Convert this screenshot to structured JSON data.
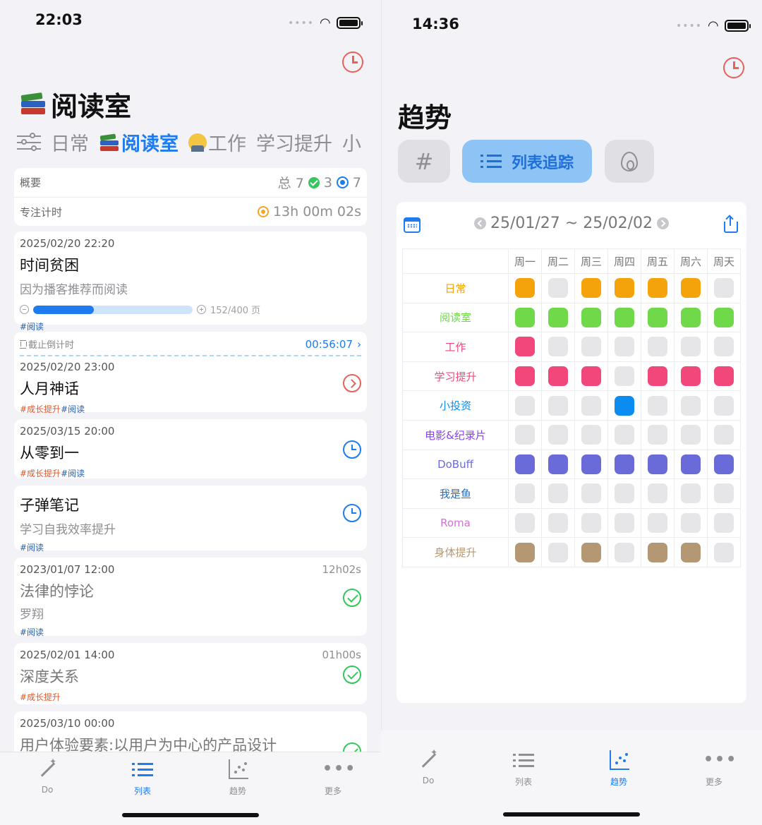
{
  "left": {
    "status_time": "22:03",
    "title": "阅读室",
    "categories": [
      "日常",
      "阅读室",
      "工作",
      "学习提升",
      "小"
    ],
    "summary": {
      "label": "概要",
      "total_label": "总 7",
      "done_count": "3",
      "target_count": "7",
      "focus_label": "专注计时",
      "focus_time": "13h 00m 02s"
    },
    "tasks": [
      {
        "date": "2025/02/20 22:20",
        "title": "时间贫困",
        "subtitle": "因为播客推荐而阅读",
        "progress_text": "152/400 页",
        "progress_fraction": 0.38,
        "tags": [
          "#阅读"
        ]
      },
      {
        "countdown_label": "截止倒计时",
        "countdown_time": "00:56:07",
        "date": "2025/02/20 23:00",
        "title": "人月神话",
        "tags": [
          "#成长提升",
          "#阅读"
        ]
      },
      {
        "date": "2025/03/15 20:00",
        "title": "从零到一",
        "tags": [
          "#成长提升",
          "#阅读"
        ]
      },
      {
        "title": "子弹笔记",
        "subtitle": "学习自我效率提升",
        "tags": [
          "#阅读"
        ]
      },
      {
        "date": "2023/01/07 12:00",
        "title": "法律的悖论",
        "subtitle": "罗翔",
        "duration": "12h02s",
        "tags": [
          "#阅读"
        ]
      },
      {
        "date": "2025/02/01 14:00",
        "title": "深度关系",
        "duration": "01h00s",
        "tags": [
          "#成长提升"
        ]
      },
      {
        "date": "2025/03/10 00:00",
        "title": "用户体验要素:以用户为中心的产品设计"
      }
    ],
    "tabs": [
      "Do",
      "列表",
      "趋势",
      "更多"
    ],
    "active_tab": "列表"
  },
  "right": {
    "status_time": "14:36",
    "title": "趋势",
    "segments": {
      "hash": "#",
      "list": "列表追踪"
    },
    "date_range": "25/01/27 ~ 25/02/02",
    "weekdays": [
      "周一",
      "周二",
      "周三",
      "周四",
      "周五",
      "周六",
      "周天"
    ],
    "rows": [
      {
        "name": "日常",
        "color": "#f5a30a",
        "days": [
          1,
          0,
          1,
          1,
          1,
          1,
          0
        ]
      },
      {
        "name": "阅读室",
        "color": "#6fd94a",
        "days": [
          1,
          1,
          1,
          1,
          1,
          1,
          1
        ]
      },
      {
        "name": "工作",
        "color": "#f2477a",
        "days": [
          1,
          0,
          0,
          0,
          0,
          0,
          0
        ]
      },
      {
        "name": "学习提升",
        "color": "#f2477a",
        "days": [
          1,
          1,
          1,
          0,
          1,
          1,
          1
        ]
      },
      {
        "name": "小投资",
        "color": "#0a8cf0",
        "days": [
          0,
          0,
          0,
          1,
          0,
          0,
          0
        ]
      },
      {
        "name": "电影&纪录片",
        "color": "#8b3ff2",
        "days": [
          0,
          0,
          0,
          0,
          0,
          0,
          0
        ]
      },
      {
        "name": "DoBuff",
        "color": "#6a6bd9",
        "days": [
          1,
          1,
          1,
          1,
          1,
          1,
          1
        ]
      },
      {
        "name": "我是鱼",
        "color": "#1f6fc8",
        "days": [
          0,
          0,
          0,
          0,
          0,
          0,
          0
        ]
      },
      {
        "name": "Roma",
        "color": "#d56fd9",
        "days": [
          0,
          0,
          0,
          0,
          0,
          0,
          0
        ]
      },
      {
        "name": "身体提升",
        "color": "#b49874",
        "days": [
          1,
          0,
          1,
          0,
          1,
          1,
          0
        ]
      }
    ],
    "tabs": [
      "Do",
      "列表",
      "趋势",
      "更多"
    ],
    "active_tab": "趋势"
  }
}
